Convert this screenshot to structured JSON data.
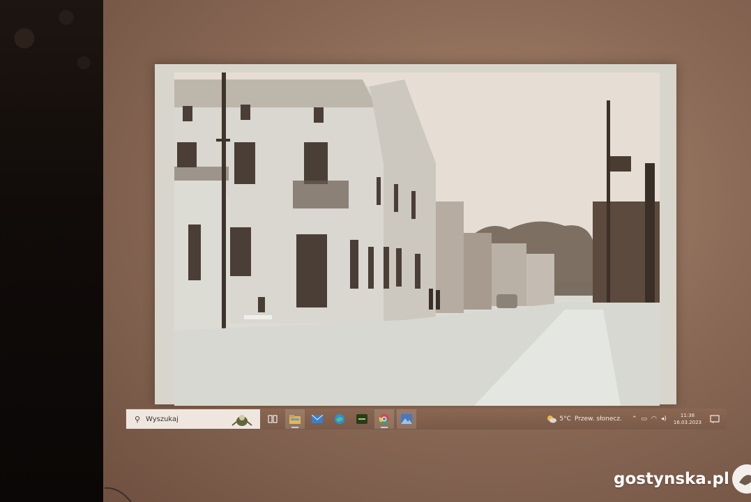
{
  "taskbar": {
    "search_placeholder": "Wyszukaj",
    "pinned_apps": [
      {
        "name": "task-view",
        "icon": "task-view-icon"
      },
      {
        "name": "file-explorer",
        "icon": "folder-icon"
      },
      {
        "name": "mail",
        "icon": "mail-icon"
      },
      {
        "name": "edge",
        "icon": "edge-icon"
      },
      {
        "name": "app-green",
        "icon": "terminal-icon"
      },
      {
        "name": "chrome",
        "icon": "chrome-icon"
      },
      {
        "name": "photos",
        "icon": "photos-icon"
      }
    ],
    "weather": {
      "temp": "5°C",
      "desc": "Przew. słonecz."
    },
    "clock": {
      "time": "11:38",
      "date": "16.03.2023"
    }
  },
  "watermark": {
    "text": "gostynska.pl"
  },
  "colors": {
    "taskbar": "#7f5f4c",
    "wall": "#8c6b58",
    "search_box": "#efe7df"
  }
}
